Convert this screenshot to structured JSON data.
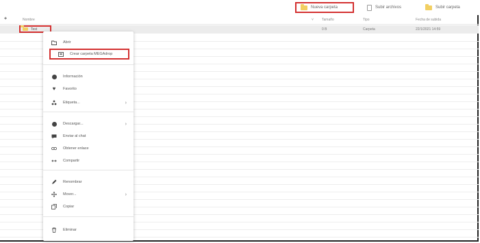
{
  "toolbar": {
    "new_folder": "Nueva carpeta",
    "upload_files": "Subir archivos",
    "upload_folder": "Subir carpeta"
  },
  "table": {
    "add_symbol": "+",
    "headers": [
      "Nombre",
      "Tamaño",
      "Tipo",
      "Fecha de subida"
    ],
    "sort_indicator": "˅",
    "rows": [
      {
        "name": "Test",
        "size": "0 B",
        "type": "Carpeta",
        "date": "22/1/2021 14:59"
      }
    ],
    "empty_rows": 27
  },
  "context_menu": {
    "items": [
      {
        "label": "Abrir",
        "icon": "folder-open-icon"
      },
      {
        "label": "Crear carpeta MEGAdrop",
        "icon": "megadrop-icon",
        "highlighted": true
      },
      {
        "label": "Información",
        "icon": "info-icon"
      },
      {
        "label": "Favorito",
        "icon": "heart-icon"
      },
      {
        "label": "Etiqueta...",
        "icon": "tag-icon",
        "submenu": true
      },
      {
        "label": "Descargar...",
        "icon": "download-icon",
        "submenu": true
      },
      {
        "label": "Enviar al chat",
        "icon": "chat-icon"
      },
      {
        "label": "Obtener enlace",
        "icon": "link-icon"
      },
      {
        "label": "Compartir",
        "icon": "share-icon"
      },
      {
        "label": "Renombrar",
        "icon": "pencil-icon"
      },
      {
        "label": "Mover...",
        "icon": "move-icon",
        "submenu": true
      },
      {
        "label": "Copiar",
        "icon": "copy-icon"
      },
      {
        "label": "Eliminar",
        "icon": "trash-icon"
      }
    ]
  },
  "colors": {
    "highlight": "#d32f2f",
    "folder": "#f2cf62",
    "selected_row": "#ececec"
  }
}
